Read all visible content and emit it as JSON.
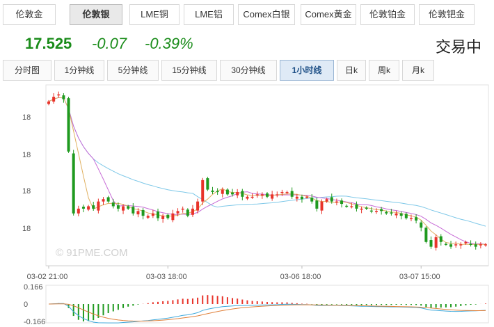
{
  "tabs": [
    "伦敦金",
    "伦敦银",
    "LME铜",
    "LME铝",
    "Comex白银",
    "Comex黄金",
    "伦敦铂金",
    "伦敦钯金"
  ],
  "active_tab": 1,
  "quote": {
    "price": "17.525",
    "change": "-0.07",
    "change_pct": "-0.39%",
    "status": "交易中"
  },
  "periods": [
    "分时图",
    "1分钟线",
    "5分钟线",
    "15分钟线",
    "30分钟线",
    "1小时线",
    "日k",
    "周k",
    "月k"
  ],
  "active_period": 5,
  "watermark": "© 91PME.COM",
  "colors": {
    "up": "#e8332a",
    "down": "#1f9a1f",
    "ma5": "#e0b060",
    "ma10": "#c76bd6",
    "ma30": "#7ec8e8",
    "dif": "#3ea9dc",
    "dea": "#e0803a"
  },
  "chart_data": {
    "type": "candlestick",
    "ylabel": "",
    "yticks": [
      "18",
      "18",
      "18",
      "18"
    ],
    "xticks": [
      {
        "index": 0,
        "label": "03-02 21:00"
      },
      {
        "index": 24,
        "label": "03-03 18:00"
      },
      {
        "index": 51,
        "label": "03-06 18:00"
      },
      {
        "index": 75,
        "label": "03-07 15:00"
      }
    ],
    "series": [
      {
        "name": "k",
        "values": []
      },
      {
        "name": "ma5",
        "values": []
      },
      {
        "name": "ma10",
        "values": []
      },
      {
        "name": "ma30",
        "values": []
      }
    ],
    "close": [
      18.19,
      18.21,
      18.22,
      18.2,
      17.98,
      17.72,
      17.74,
      17.74,
      17.75,
      17.74,
      17.77,
      17.78,
      17.77,
      17.75,
      17.74,
      17.75,
      17.74,
      17.72,
      17.73,
      17.71,
      17.71,
      17.72,
      17.7,
      17.71,
      17.7,
      17.72,
      17.73,
      17.74,
      17.71,
      17.74,
      17.77,
      17.86,
      17.82,
      17.81,
      17.81,
      17.82,
      17.8,
      17.8,
      17.81,
      17.79,
      17.79,
      17.79,
      17.8,
      17.8,
      17.79,
      17.8,
      17.8,
      17.81,
      17.81,
      17.79,
      17.79,
      17.78,
      17.79,
      17.77,
      17.74,
      17.77,
      17.78,
      17.77,
      17.77,
      17.76,
      17.75,
      17.75,
      17.74,
      17.74,
      17.74,
      17.73,
      17.73,
      17.73,
      17.72,
      17.72,
      17.72,
      17.71,
      17.7,
      17.7,
      17.69,
      17.66,
      17.6,
      17.58,
      17.62,
      17.6,
      17.59,
      17.58,
      17.59,
      17.59,
      17.6,
      17.59,
      17.58,
      17.59,
      17.59
    ],
    "macd": {
      "ylim": [
        -0.166,
        0.166
      ],
      "yticks": [
        "0.166",
        "0",
        "-0.166"
      ]
    }
  }
}
